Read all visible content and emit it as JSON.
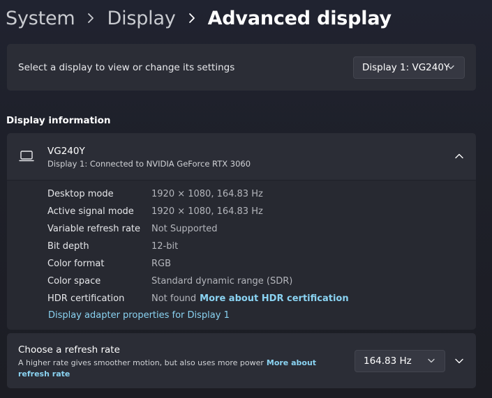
{
  "breadcrumb": {
    "items": [
      "System",
      "Display"
    ],
    "current": "Advanced display"
  },
  "display_select": {
    "label": "Select a display to view or change its settings",
    "selected": "Display 1: VG240Y"
  },
  "display_information": {
    "heading": "Display information",
    "name": "VG240Y",
    "subtitle": "Display 1: Connected to NVIDIA GeForce RTX 3060",
    "rows": [
      {
        "key": "Desktop mode",
        "value": "1920 × 1080, 164.83 Hz"
      },
      {
        "key": "Active signal mode",
        "value": "1920 × 1080, 164.83 Hz"
      },
      {
        "key": "Variable refresh rate",
        "value": "Not Supported"
      },
      {
        "key": "Bit depth",
        "value": "12-bit"
      },
      {
        "key": "Color format",
        "value": "RGB"
      },
      {
        "key": "Color space",
        "value": "Standard dynamic range (SDR)"
      },
      {
        "key": "HDR certification",
        "value": "Not found",
        "link": "More about HDR certification"
      }
    ],
    "adapter_link": "Display adapter properties for Display 1"
  },
  "refresh_rate": {
    "title": "Choose a refresh rate",
    "description": "A higher rate gives smoother motion, but also uses more power",
    "link": "More about refresh rate",
    "selected": "164.83 Hz"
  },
  "icons": {
    "breadcrumb_separator": "chevron-right-icon",
    "dropdown": "chevron-down-icon",
    "monitor": "laptop-icon",
    "collapse": "chevron-up-icon"
  },
  "colors": {
    "accent_link": "#8ad3f2",
    "card_background": "#2b2d36"
  }
}
